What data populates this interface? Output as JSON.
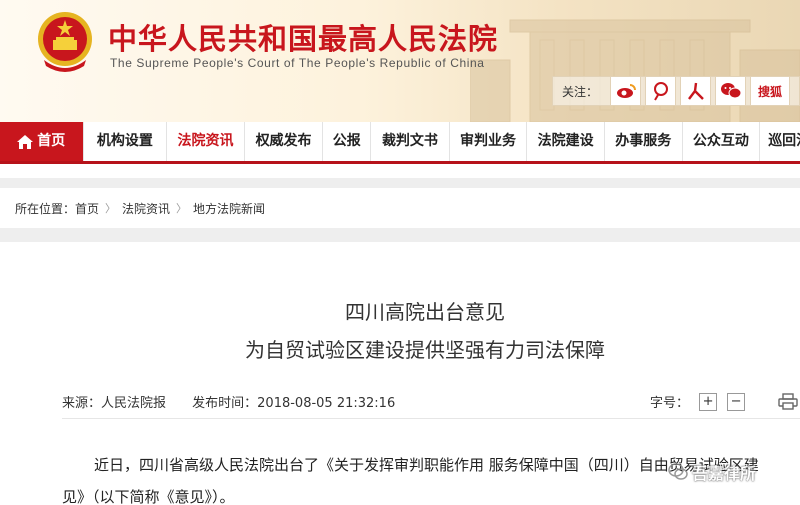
{
  "header": {
    "title_cn": "中华人民共和国最高人民法院",
    "title_en": "The Supreme People's Court of The People's Republic of China",
    "follow_label": "关注：",
    "social_icons": [
      "weibo-icon",
      "tencent-weibo-icon",
      "people-weibo-icon",
      "wechat-icon",
      "sohu-icon"
    ],
    "sohu_label": "搜狐"
  },
  "nav": {
    "items": [
      {
        "label": "首页"
      },
      {
        "label": "机构设置"
      },
      {
        "label": "法院资讯"
      },
      {
        "label": "权威发布"
      },
      {
        "label": "公报"
      },
      {
        "label": "裁判文书"
      },
      {
        "label": "审判业务"
      },
      {
        "label": "法院建设"
      },
      {
        "label": "办事服务"
      },
      {
        "label": "公众互动"
      },
      {
        "label": "巡回法"
      }
    ],
    "active_index": 2,
    "accent": "#c8161d"
  },
  "breadcrumb": {
    "prefix": "所在位置：",
    "items": [
      "首页",
      "法院资讯",
      "地方法院新闻"
    ],
    "separator": "〉"
  },
  "article": {
    "title_line1": "四川高院出台意见",
    "title_line2": "为自贸试验区建设提供坚强有力司法保障",
    "source": "来源：人民法院报",
    "publish_time": "发布时间：2018-08-05 21:32:16",
    "font_size_label": "字号：",
    "font_increase": "+",
    "font_decrease": "−",
    "paragraph1": "近日，四川省高级人民法院出台了《关于发挥审判职能作用 服务保障中国（四川）自由贸易试验区建",
    "paragraph2": "见》（以下简称《意见》）。"
  },
  "watermark": {
    "text": "吾嘉律所"
  }
}
